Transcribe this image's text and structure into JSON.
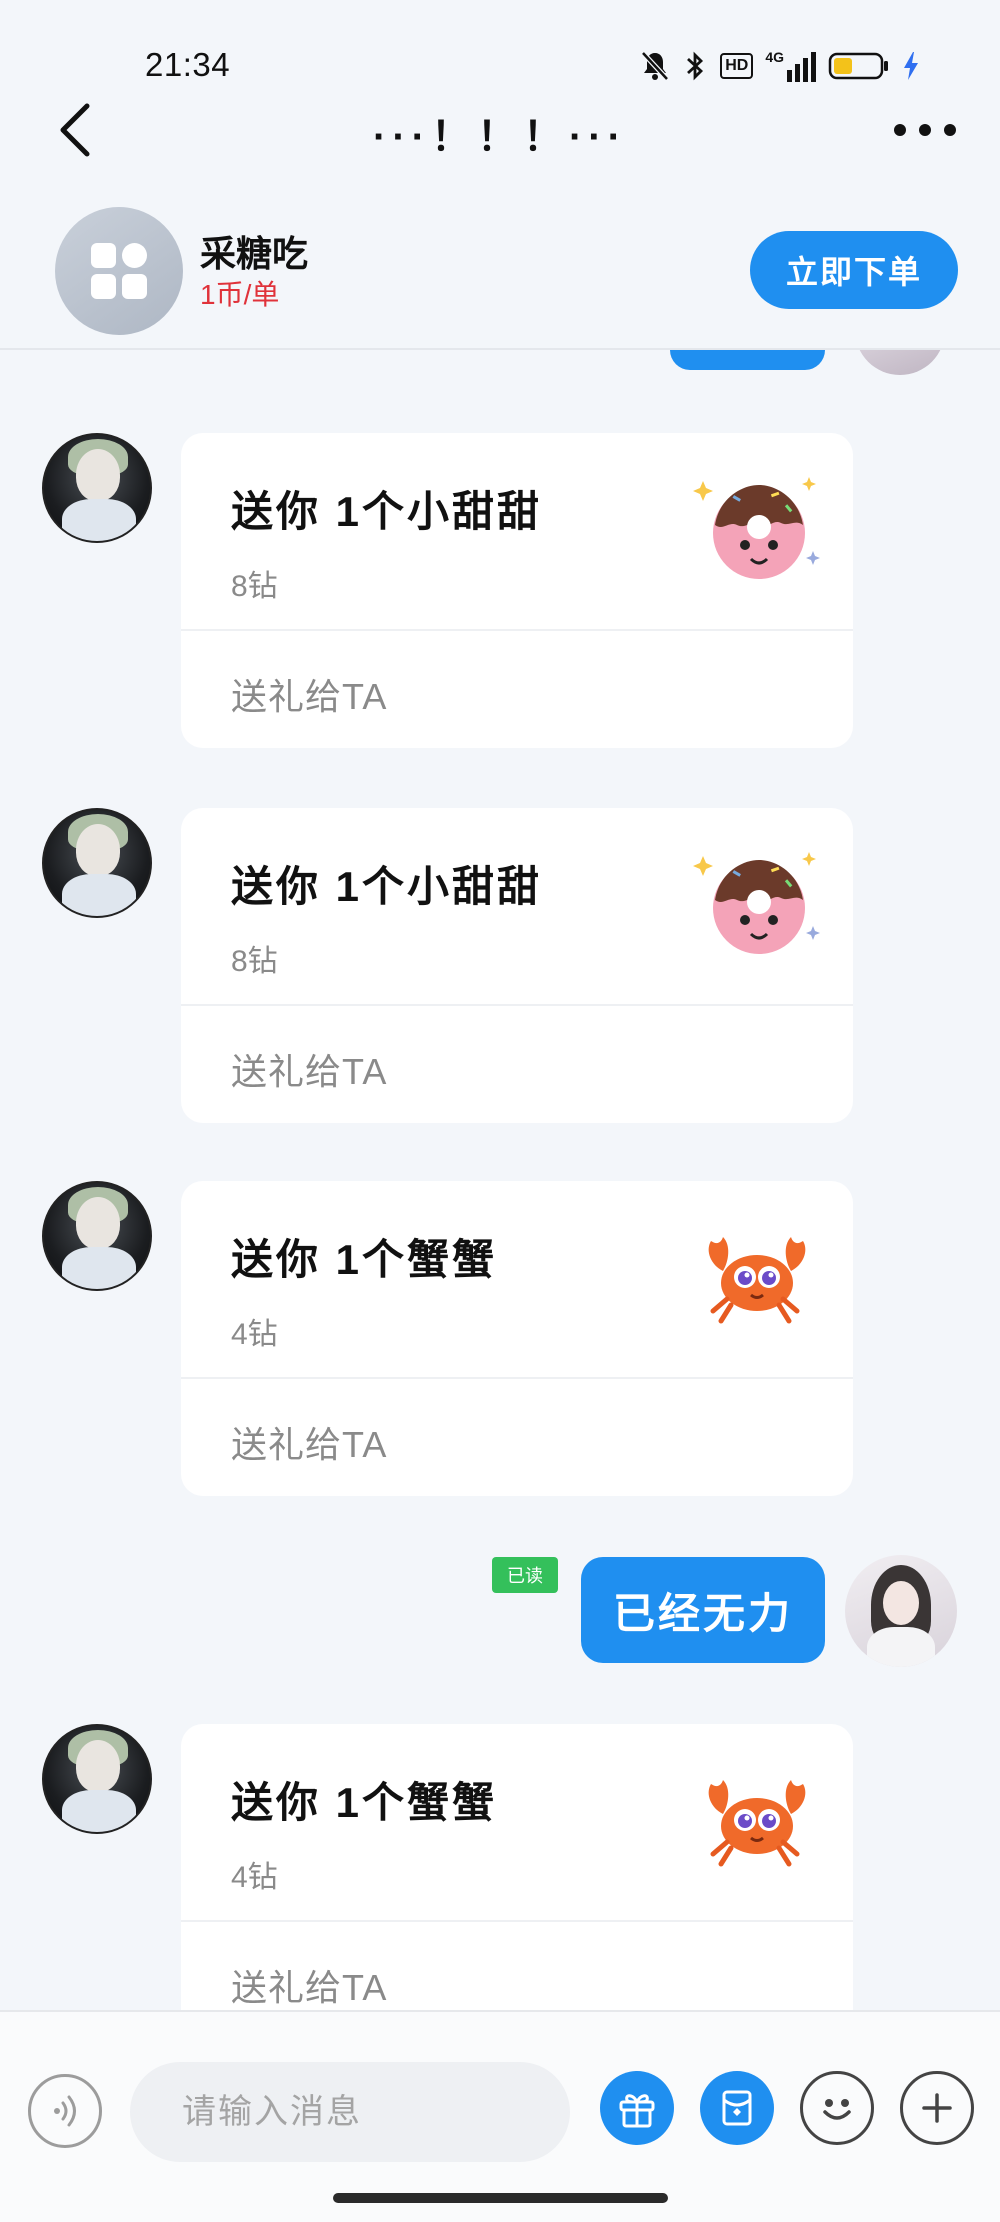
{
  "status_bar": {
    "time": "21:34",
    "icons": [
      "mute-icon",
      "bluetooth-icon",
      "hd-icon",
      "signal-4g-icon",
      "battery-icon",
      "charging-icon"
    ],
    "hd_label": "HD",
    "network_label": "4G"
  },
  "nav": {
    "title": "···！！！···"
  },
  "order_header": {
    "service_name": "采糖吃",
    "price": "1币/单",
    "order_button_label": "立即下单"
  },
  "messages": [
    {
      "type": "gift",
      "title": "送你 1个小甜甜",
      "price": "8钻",
      "action": "送礼给TA",
      "gift_icon": "donut-icon"
    },
    {
      "type": "gift",
      "title": "送你 1个小甜甜",
      "price": "8钻",
      "action": "送礼给TA",
      "gift_icon": "donut-icon"
    },
    {
      "type": "gift",
      "title": "送你 1个蟹蟹",
      "price": "4钻",
      "action": "送礼给TA",
      "gift_icon": "crab-icon"
    },
    {
      "type": "text",
      "direction": "sent",
      "text": "已经无力",
      "read_label": "已读"
    },
    {
      "type": "gift",
      "title": "送你 1个蟹蟹",
      "price": "4钻",
      "action": "送礼给TA",
      "gift_icon": "crab-icon"
    }
  ],
  "input_bar": {
    "placeholder": "请输入消息"
  },
  "colors": {
    "accent": "#1f8ff0",
    "price_red": "#e0323a",
    "read_green": "#34c05b",
    "background": "#f3f6fa"
  }
}
